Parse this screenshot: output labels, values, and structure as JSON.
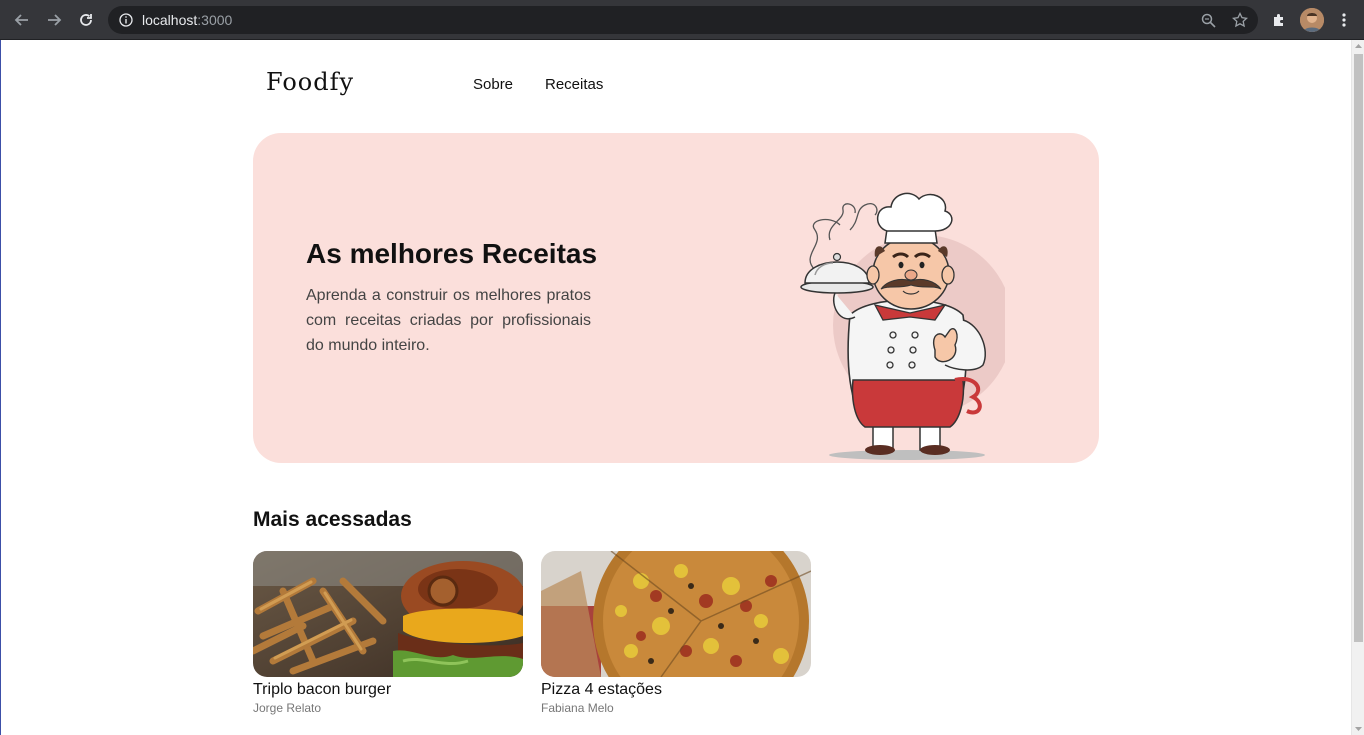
{
  "browser": {
    "url_host": "localhost",
    "url_port": ":3000"
  },
  "header": {
    "logo": "Foodfy",
    "nav": [
      {
        "label": "Sobre"
      },
      {
        "label": "Receitas"
      }
    ]
  },
  "hero": {
    "title": "As melhores Receitas",
    "text": "Aprenda a construir os melhores pratos com receitas criadas por profissionais do mundo inteiro.",
    "background": "#fbdfdb"
  },
  "section": {
    "title": "Mais acessadas"
  },
  "recipes": [
    {
      "title": "Triplo bacon burger",
      "author": "Jorge Relato"
    },
    {
      "title": "Pizza 4 estações",
      "author": "Fabiana Melo"
    }
  ]
}
